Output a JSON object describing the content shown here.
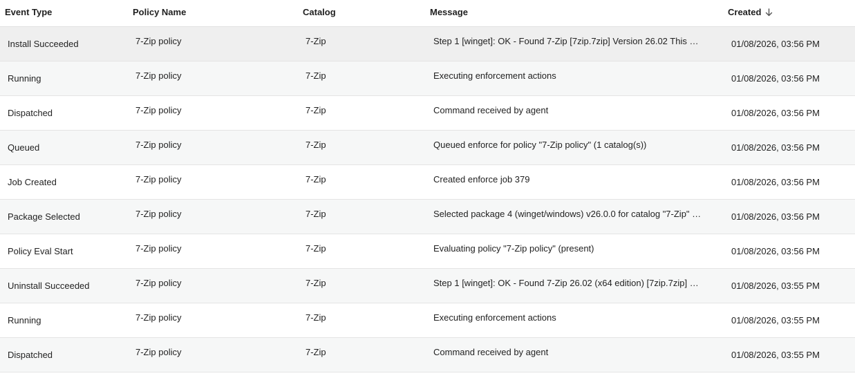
{
  "table": {
    "headers": {
      "event_type": "Event Type",
      "policy_name": "Policy Name",
      "catalog": "Catalog",
      "message": "Message",
      "created": "Created",
      "created_sort_icon": "arrow-down-icon"
    },
    "rows": [
      {
        "event_type": "Install Succeeded",
        "policy_name": "7-Zip policy",
        "catalog": "7-Zip",
        "message": "Step 1 [winget]: OK - Found 7-Zip [7zip.7zip] Version 26.02 This …",
        "created": "01/08/2026, 03:56 PM"
      },
      {
        "event_type": "Running",
        "policy_name": "7-Zip policy",
        "catalog": "7-Zip",
        "message": "Executing enforcement actions",
        "created": "01/08/2026, 03:56 PM"
      },
      {
        "event_type": "Dispatched",
        "policy_name": "7-Zip policy",
        "catalog": "7-Zip",
        "message": "Command received by agent",
        "created": "01/08/2026, 03:56 PM"
      },
      {
        "event_type": "Queued",
        "policy_name": "7-Zip policy",
        "catalog": "7-Zip",
        "message": "Queued enforce for policy \"7-Zip policy\" (1 catalog(s))",
        "created": "01/08/2026, 03:56 PM"
      },
      {
        "event_type": "Job Created",
        "policy_name": "7-Zip policy",
        "catalog": "7-Zip",
        "message": "Created enforce job 379",
        "created": "01/08/2026, 03:56 PM"
      },
      {
        "event_type": "Package Selected",
        "policy_name": "7-Zip policy",
        "catalog": "7-Zip",
        "message": "Selected package 4 (winget/windows) v26.0.0 for catalog \"7-Zip\" …",
        "created": "01/08/2026, 03:56 PM"
      },
      {
        "event_type": "Policy Eval Start",
        "policy_name": "7-Zip policy",
        "catalog": "7-Zip",
        "message": "Evaluating policy \"7-Zip policy\" (present)",
        "created": "01/08/2026, 03:56 PM"
      },
      {
        "event_type": "Uninstall Succeeded",
        "policy_name": "7-Zip policy",
        "catalog": "7-Zip",
        "message": "Step 1 [winget]: OK - Found 7-Zip 26.02 (x64 edition) [7zip.7zip] …",
        "created": "01/08/2026, 03:55 PM"
      },
      {
        "event_type": "Running",
        "policy_name": "7-Zip policy",
        "catalog": "7-Zip",
        "message": "Executing enforcement actions",
        "created": "01/08/2026, 03:55 PM"
      },
      {
        "event_type": "Dispatched",
        "policy_name": "7-Zip policy",
        "catalog": "7-Zip",
        "message": "Command received by agent",
        "created": "01/08/2026, 03:55 PM"
      }
    ]
  }
}
